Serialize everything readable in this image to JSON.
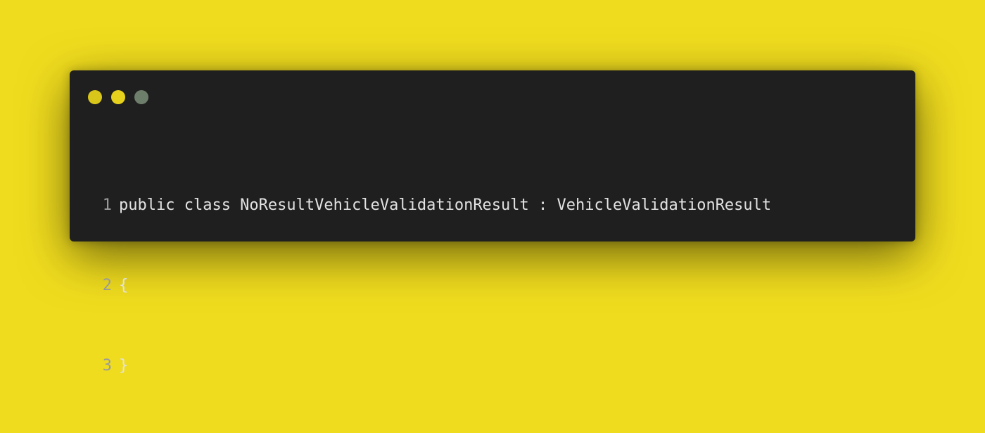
{
  "window": {
    "controls": [
      {
        "name": "close",
        "color": "#d9c61a"
      },
      {
        "name": "minimize",
        "color": "#e6d21c"
      },
      {
        "name": "maximize",
        "color": "#6d7e6a"
      }
    ]
  },
  "code": {
    "language": "csharp",
    "lines": [
      {
        "number": "1",
        "text": "public class NoResultVehicleValidationResult : VehicleValidationResult"
      },
      {
        "number": "2",
        "text": "{"
      },
      {
        "number": "3",
        "text": "}"
      }
    ]
  },
  "colors": {
    "background": "#f0dc1e",
    "editor": "#1f1f1f",
    "text": "#e2e2e2",
    "line_numbers": "#9a9a9a"
  }
}
